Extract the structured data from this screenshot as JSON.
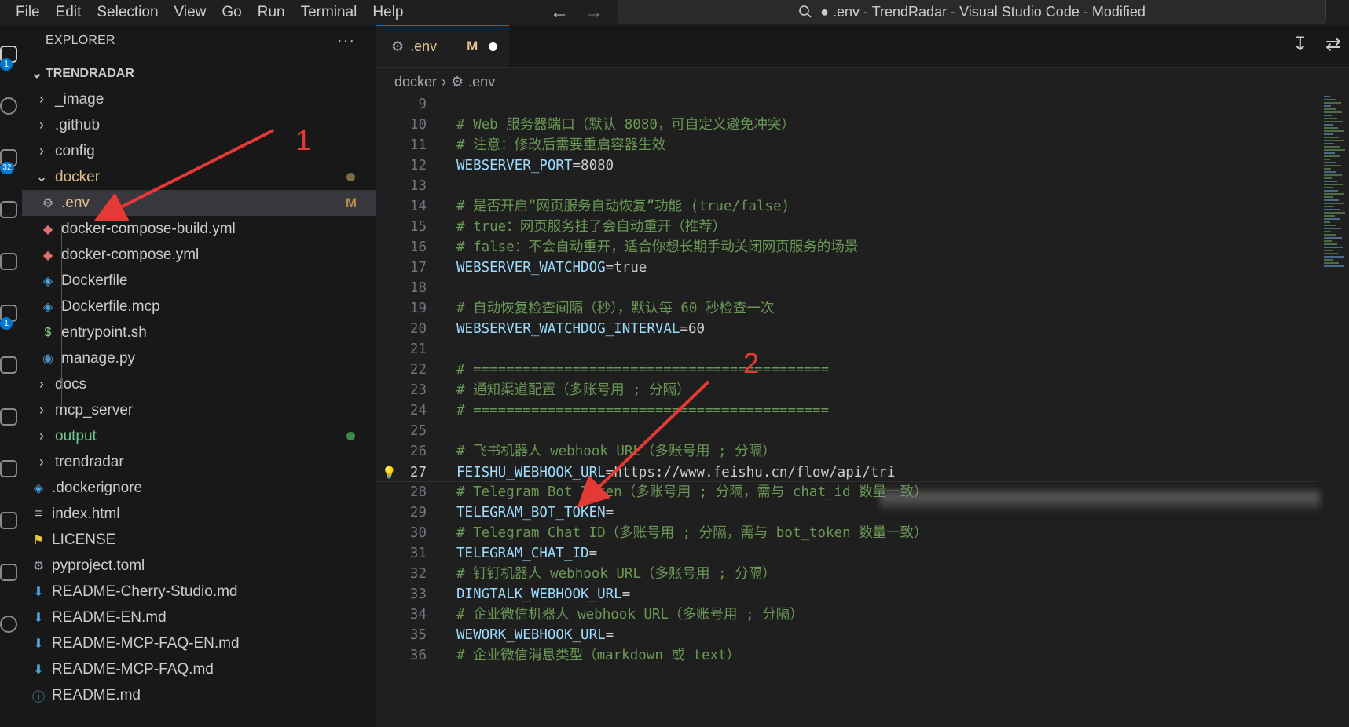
{
  "menu": [
    "File",
    "Edit",
    "Selection",
    "View",
    "Go",
    "Run",
    "Terminal",
    "Help"
  ],
  "window_title": "● .env - TrendRadar - Visual Studio Code - Modified",
  "activity_badges": [
    "1",
    "32",
    "1"
  ],
  "explorer": {
    "title": "EXPLORER",
    "more": "···",
    "root": "TRENDRADAR",
    "items": [
      {
        "label": "_image",
        "kind": "folder"
      },
      {
        "label": ".github",
        "kind": "folder"
      },
      {
        "label": "config",
        "kind": "folder"
      },
      {
        "label": "docker",
        "kind": "folder-open",
        "color": "#e2c08d"
      },
      {
        "label": ".env",
        "kind": "file",
        "color": "#e2c08d",
        "status": "M"
      },
      {
        "label": "docker-compose-build.yml",
        "kind": "file"
      },
      {
        "label": "docker-compose.yml",
        "kind": "file"
      },
      {
        "label": "Dockerfile",
        "kind": "file"
      },
      {
        "label": "Dockerfile.mcp",
        "kind": "file"
      },
      {
        "label": "entrypoint.sh",
        "kind": "file"
      },
      {
        "label": "manage.py",
        "kind": "file"
      },
      {
        "label": "docs",
        "kind": "folder"
      },
      {
        "label": "mcp_server",
        "kind": "folder"
      },
      {
        "label": "output",
        "kind": "folder",
        "color": "#73c991"
      },
      {
        "label": "trendradar",
        "kind": "folder"
      },
      {
        "label": ".dockerignore",
        "kind": "file"
      },
      {
        "label": "index.html",
        "kind": "file"
      },
      {
        "label": "LICENSE",
        "kind": "file"
      },
      {
        "label": "pyproject.toml",
        "kind": "file"
      },
      {
        "label": "README-Cherry-Studio.md",
        "kind": "file"
      },
      {
        "label": "README-EN.md",
        "kind": "file"
      },
      {
        "label": "README-MCP-FAQ-EN.md",
        "kind": "file"
      },
      {
        "label": "README-MCP-FAQ.md",
        "kind": "file"
      },
      {
        "label": "README.md",
        "kind": "file"
      }
    ]
  },
  "tab": {
    "label": ".env",
    "status": "M"
  },
  "breadcrumb": [
    "docker",
    ".env"
  ],
  "code_lines": [
    {
      "n": "9",
      "text": ""
    },
    {
      "n": "10",
      "text": "# Web 服务器端口（默认 8080，可自定义避免冲突）",
      "type": "comment"
    },
    {
      "n": "11",
      "text": "# 注意：修改后需要重启容器生效",
      "type": "comment"
    },
    {
      "n": "12",
      "key": "WEBSERVER_PORT",
      "val": "=8080"
    },
    {
      "n": "13",
      "text": ""
    },
    {
      "n": "14",
      "text": "# 是否开启“网页服务自动恢复”功能 (true/false)",
      "type": "comment"
    },
    {
      "n": "15",
      "text": "# true：网页服务挂了会自动重开（推荐）",
      "type": "comment"
    },
    {
      "n": "16",
      "text": "# false：不会自动重开，适合你想长期手动关闭网页服务的场景",
      "type": "comment"
    },
    {
      "n": "17",
      "key": "WEBSERVER_WATCHDOG",
      "val": "=true"
    },
    {
      "n": "18",
      "text": ""
    },
    {
      "n": "19",
      "text": "# 自动恢复检查间隔（秒），默认每 60 秒检查一次",
      "type": "comment"
    },
    {
      "n": "20",
      "key": "WEBSERVER_WATCHDOG_INTERVAL",
      "val": "=60"
    },
    {
      "n": "21",
      "text": ""
    },
    {
      "n": "22",
      "text": "# ===========================================",
      "type": "comment"
    },
    {
      "n": "23",
      "text": "# 通知渠道配置（多账号用 ; 分隔）",
      "type": "comment"
    },
    {
      "n": "24",
      "text": "# ===========================================",
      "type": "comment"
    },
    {
      "n": "25",
      "text": ""
    },
    {
      "n": "26",
      "text": "# 飞书机器人 webhook URL（多账号用 ; 分隔）",
      "type": "comment"
    },
    {
      "n": "27",
      "key": "FEISHU_WEBHOOK_URL",
      "val": "=https://www.feishu.cn/flow/api/tri",
      "active": true
    },
    {
      "n": "28",
      "text": "# Telegram Bot Token（多账号用 ; 分隔，需与 chat_id 数量一致）",
      "type": "comment"
    },
    {
      "n": "29",
      "key": "TELEGRAM_BOT_TOKEN",
      "val": "="
    },
    {
      "n": "30",
      "text": "# Telegram Chat ID（多账号用 ; 分隔，需与 bot_token 数量一致）",
      "type": "comment"
    },
    {
      "n": "31",
      "key": "TELEGRAM_CHAT_ID",
      "val": "="
    },
    {
      "n": "32",
      "text": "# 钉钉机器人 webhook URL（多账号用 ; 分隔）",
      "type": "comment"
    },
    {
      "n": "33",
      "key": "DINGTALK_WEBHOOK_URL",
      "val": "="
    },
    {
      "n": "34",
      "text": "# 企业微信机器人 webhook URL（多账号用 ; 分隔）",
      "type": "comment"
    },
    {
      "n": "35",
      "key": "WEWORK_WEBHOOK_URL",
      "val": "="
    },
    {
      "n": "36",
      "text": "# 企业微信消息类型（markdown 或 text）",
      "type": "comment"
    }
  ],
  "annotations": [
    "1",
    "2"
  ]
}
